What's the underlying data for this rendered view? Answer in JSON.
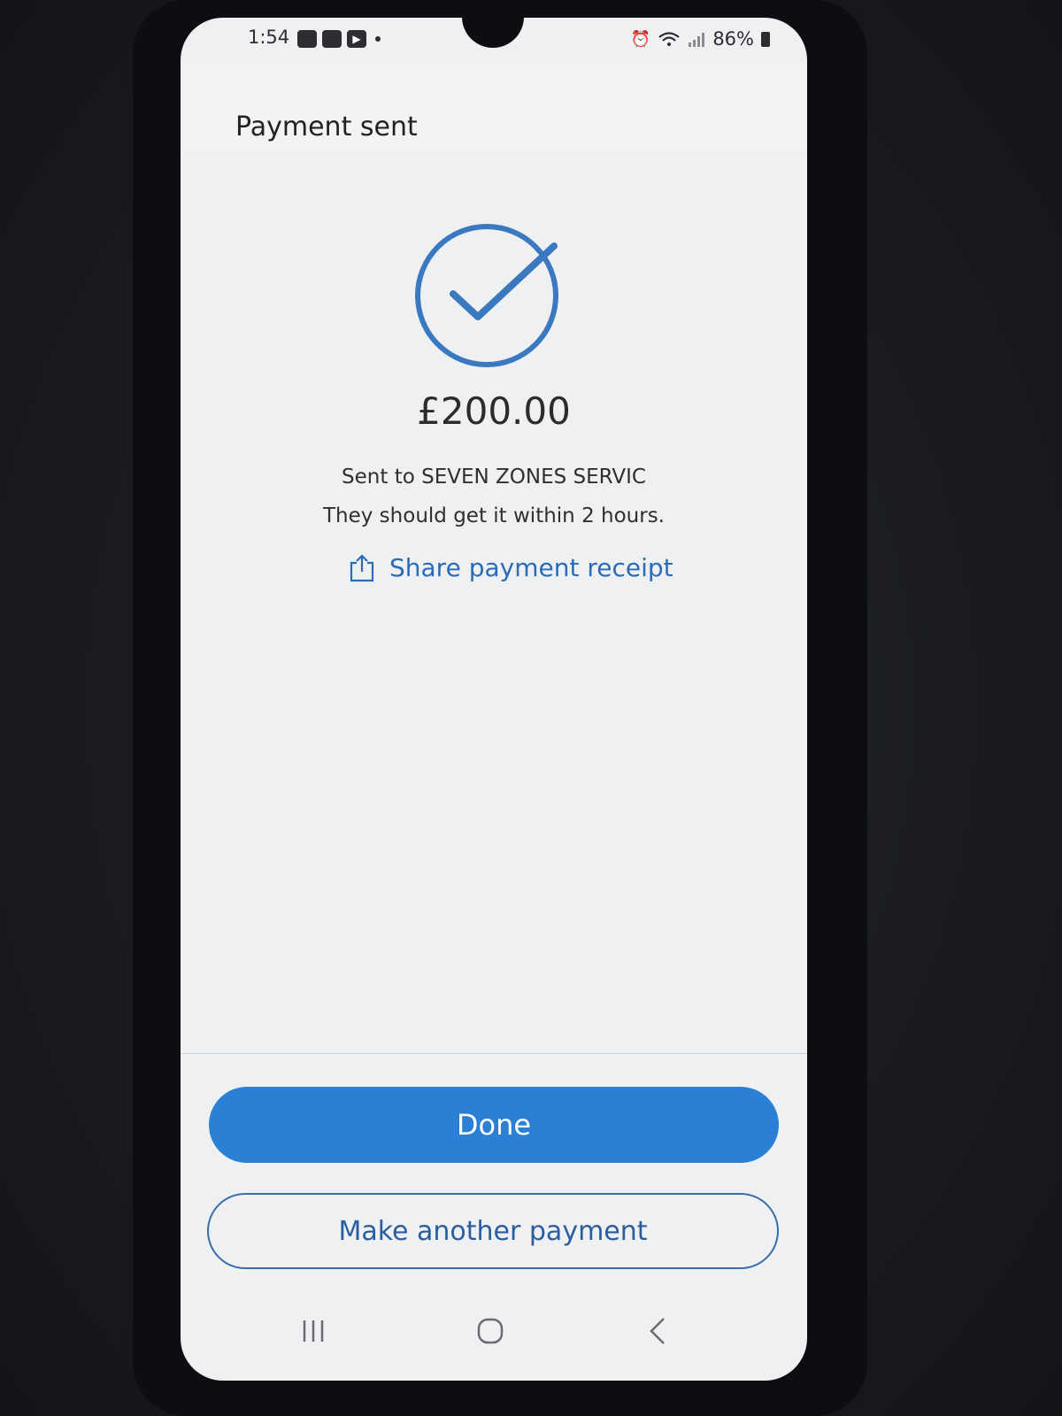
{
  "status_bar": {
    "time": "1:54",
    "battery_percent": "86%",
    "icons": [
      "app-notification-icon",
      "app-notification-icon",
      "youtube-icon",
      "alarm-icon",
      "wifi-icon",
      "signal-icon",
      "battery-icon"
    ]
  },
  "header": {
    "title": "Payment sent"
  },
  "confirmation": {
    "icon": "check-circle-icon",
    "amount": "£200.00",
    "recipient_line": "Sent to SEVEN ZONES SERVIC",
    "eta_line": "They should get it within 2 hours.",
    "share_label": "Share payment receipt"
  },
  "actions": {
    "done_label": "Done",
    "another_label": "Make another payment"
  },
  "colors": {
    "accent": "#2b7fd4",
    "link": "#2a6cb8",
    "check": "#3a78bf"
  }
}
